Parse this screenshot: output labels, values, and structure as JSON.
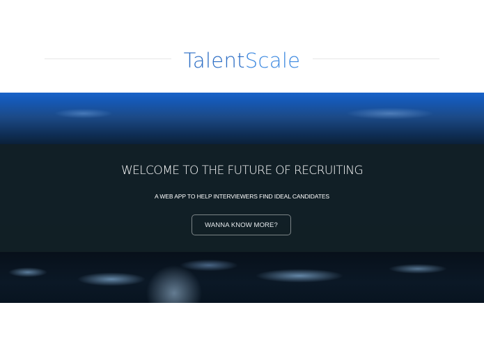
{
  "header": {
    "brand_part1": "Talent",
    "brand_part2": "Scale"
  },
  "hero": {
    "headline": "WELCOME TO THE FUTURE OF RECRUITING",
    "subheadline": "A WEB APP TO HELP INTERVIEWERS FIND IDEAL CANDIDATES",
    "cta_label": "WANNA KNOW MORE?"
  },
  "colors": {
    "brand_blue": "#2a6cc4",
    "brand_blue_light": "#3b88e0",
    "overlay": "#131f24"
  }
}
